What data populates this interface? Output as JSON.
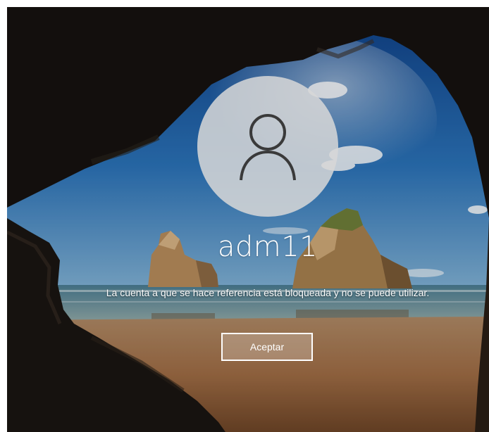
{
  "lock_screen": {
    "avatar_icon": "user-icon",
    "username": "adm11",
    "message": "La cuenta a que se hace referencia está bloqueada y no se puede utilizar.",
    "ok_label": "Aceptar"
  },
  "colors": {
    "text": "#ffffff",
    "avatar_background": "#d7d7d7",
    "avatar_glyph": "#3a3a3a",
    "sky": "#1f5fa6",
    "sea": "#3f6e86",
    "sand": "#b88a60",
    "cave_rock": "#141210"
  }
}
